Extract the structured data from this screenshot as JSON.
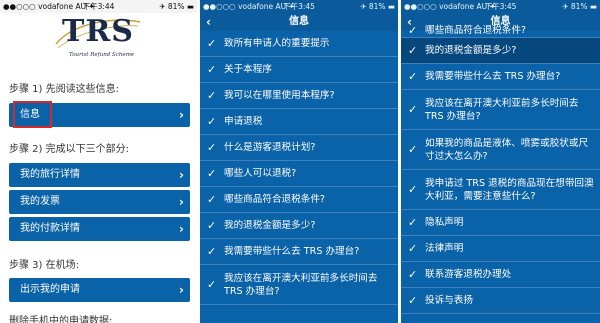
{
  "status": {
    "carrier": "●●○○○ vodafone AU ✦",
    "time_left": "下午3:44",
    "time_mid": "下午3:45",
    "time_right": "下午3:45",
    "battery": "✈ 81% ▬"
  },
  "panel1": {
    "logo_text": "TRS",
    "logo_subtitle": "Tourist Refund Scheme",
    "step1_label": "步骤 1) 先阅读这些信息:",
    "info_button": "信息",
    "step2_label": "步骤 2) 完成以下三个部分:",
    "travel_details": "我的旅行详情",
    "my_invoices": "我的发票",
    "payment_details": "我的付款详情",
    "step3_label": "步骤 3) 在机场:",
    "show_application": "出示我的申请",
    "bottom_partial": "删除手机中的申请数据:"
  },
  "panel2": {
    "back_icon": "back-arrow-icon",
    "title": "信息",
    "items": [
      "致所有申请人的重要提示",
      "关于本程序",
      "我可以在哪里使用本程序?",
      "申请退税",
      "什么是游客退税计划?",
      "哪些人可以退税?",
      "哪些商品符合退税条件?",
      "我的退税金额是多少?",
      "我需要带些什么去 TRS 办理台?",
      "我应该在离开澳大利亚前多长时间去 TRS 办理台?"
    ]
  },
  "panel3": {
    "back_icon": "back-arrow-icon",
    "title": "信息",
    "items": [
      "哪些商品符合退税条件?",
      "我的退税金额是多少?",
      "我需要带些什么去 TRS 办理台?",
      "我应该在离开澳大利亚前多长时间去 TRS 办理台?",
      "如果我的商品是液体、喷雾或胶状或尺寸过大怎么办?",
      "我申请过 TRS 退税的商品现在想带回澳大利亚，需要注意些什么?",
      "隐私声明",
      "法律声明",
      "联系游客退税办理处",
      "投诉与表扬"
    ]
  },
  "colors": {
    "primary_blue": "#0a62a8",
    "selected_blue": "#06477e",
    "highlight_red": "#d32a2a"
  }
}
